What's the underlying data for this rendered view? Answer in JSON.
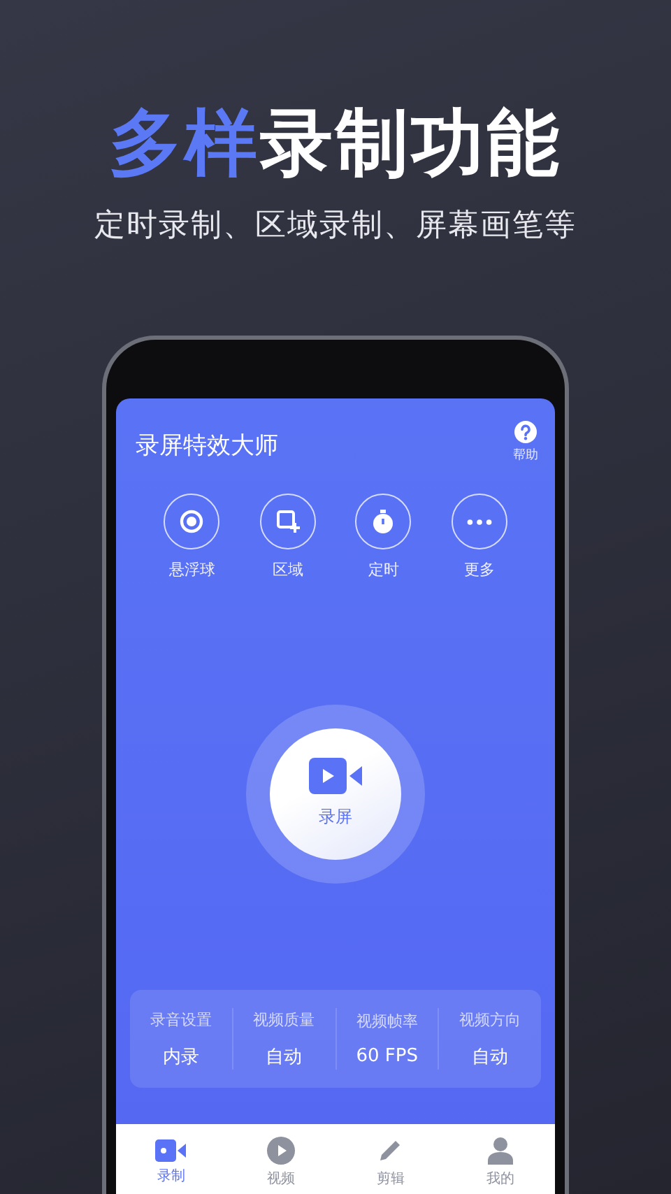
{
  "headline": {
    "accent": "多样",
    "rest": "录制功能"
  },
  "subtitle": "定时录制、区域录制、屏幕画笔等",
  "app": {
    "title": "录屏特效大师",
    "help": "帮助",
    "tools": [
      {
        "label": "悬浮球"
      },
      {
        "label": "区域"
      },
      {
        "label": "定时"
      },
      {
        "label": "更多"
      }
    ],
    "record": "录屏",
    "settings": [
      {
        "label": "录音设置",
        "value": "内录"
      },
      {
        "label": "视频质量",
        "value": "自动"
      },
      {
        "label": "视频帧率",
        "value": "60 FPS"
      },
      {
        "label": "视频方向",
        "value": "自动"
      }
    ],
    "nav": [
      {
        "label": "录制",
        "selected": true
      },
      {
        "label": "视频",
        "selected": false
      },
      {
        "label": "剪辑",
        "selected": false
      },
      {
        "label": "我的",
        "selected": false
      }
    ]
  }
}
